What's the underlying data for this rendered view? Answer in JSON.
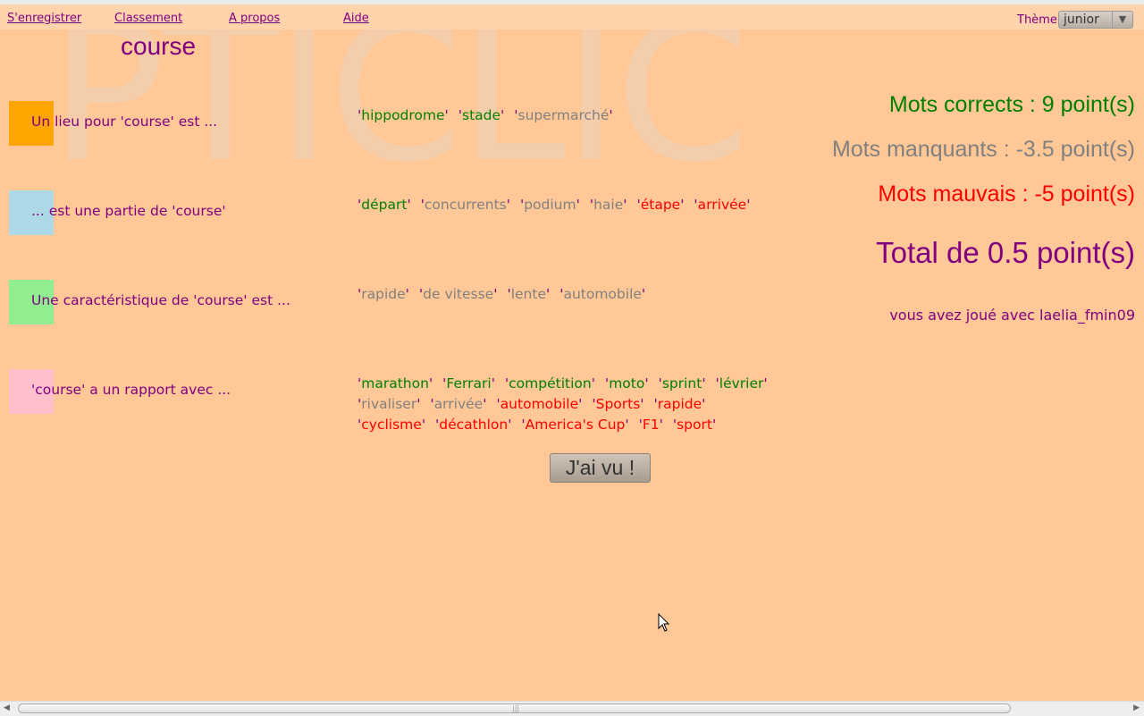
{
  "nav": {
    "items": [
      {
        "label": "S'enregistrer"
      },
      {
        "label": "Classement"
      },
      {
        "label": "A propos"
      },
      {
        "label": "Aide"
      }
    ],
    "theme_label": "Thème",
    "theme_value": "junior"
  },
  "watermark": "PTICLIC",
  "word": "course",
  "colors": {
    "background": "#ffc896",
    "text_primary": "#800080",
    "correct": "#008000",
    "missing": "#808080",
    "wrong": "#ff0000"
  },
  "rows": [
    {
      "label": "Un lieu pour 'course' est ...",
      "color": "#ffa500",
      "answers": [
        {
          "text": "hippodrome",
          "status": "correct"
        },
        {
          "text": "stade",
          "status": "correct"
        },
        {
          "text": "supermarché",
          "status": "missing"
        }
      ]
    },
    {
      "label": "... est une partie de 'course'",
      "color": "#add8e6",
      "answers": [
        {
          "text": "départ",
          "status": "correct"
        },
        {
          "text": "concurrents",
          "status": "missing"
        },
        {
          "text": "podium",
          "status": "missing"
        },
        {
          "text": "haie",
          "status": "missing"
        },
        {
          "text": "étape",
          "status": "wrong"
        },
        {
          "text": "arrivée",
          "status": "wrong"
        }
      ]
    },
    {
      "label": "Une caractéristique de 'course' est ...",
      "color": "#90ee90",
      "answers": [
        {
          "text": "rapide",
          "status": "missing"
        },
        {
          "text": "de vitesse",
          "status": "missing"
        },
        {
          "text": "lente",
          "status": "missing"
        },
        {
          "text": "automobile",
          "status": "missing"
        }
      ]
    },
    {
      "label": "'course' a un rapport avec ...",
      "color": "#ffc0cb",
      "answers": [
        {
          "text": "marathon",
          "status": "correct"
        },
        {
          "text": "Ferrari",
          "status": "correct"
        },
        {
          "text": "compétition",
          "status": "correct"
        },
        {
          "text": "moto",
          "status": "correct"
        },
        {
          "text": "sprint",
          "status": "correct"
        },
        {
          "text": "lévrier",
          "status": "correct"
        },
        {
          "text": "rivaliser",
          "status": "missing"
        },
        {
          "text": "arrivée",
          "status": "missing"
        },
        {
          "text": "automobile",
          "status": "wrong"
        },
        {
          "text": "Sports",
          "status": "wrong"
        },
        {
          "text": "rapide",
          "status": "wrong"
        },
        {
          "text": "cyclisme",
          "status": "wrong"
        },
        {
          "text": "décathlon",
          "status": "wrong"
        },
        {
          "text": "America's Cup",
          "status": "wrong"
        },
        {
          "text": "F1",
          "status": "wrong"
        },
        {
          "text": "sport",
          "status": "wrong"
        }
      ]
    }
  ],
  "scores": {
    "correct": "Mots corrects : 9 point(s)",
    "missing": "Mots manquants : -3.5 point(s)",
    "wrong": "Mots mauvais : -5 point(s)",
    "total": "Total de 0.5 point(s)",
    "partner": "vous avez joué avec laelia_fmin09"
  },
  "button": {
    "label": "J'ai vu !"
  }
}
